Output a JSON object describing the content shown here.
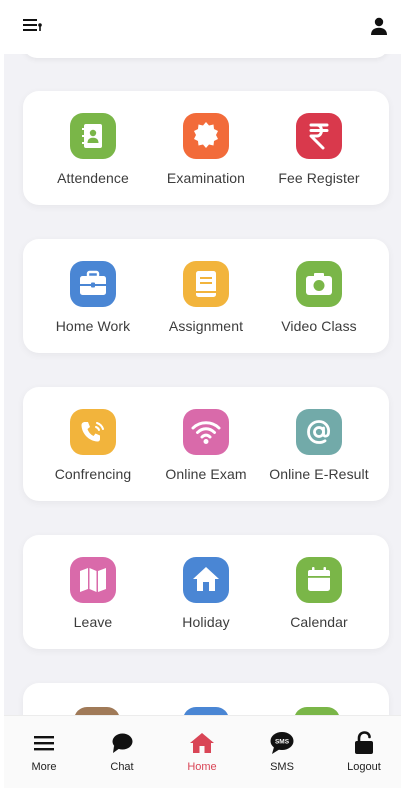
{
  "header": {
    "menu_icon": "menu-lines-icon",
    "user_icon": "user-icon"
  },
  "colors": {
    "green": "#7ab648",
    "orange": "#f26b3a",
    "red": "#d9394c",
    "blue": "#4a86d4",
    "yellow": "#f2b43c",
    "pink": "#d96aaa",
    "teal": "#72aaa9",
    "brown": "#a07a58",
    "active": "#d94556"
  },
  "cards": [
    {
      "items": [
        {
          "label": "Attendence",
          "icon": "contact-book-icon",
          "color": "#7ab648"
        },
        {
          "label": "Examination",
          "icon": "badge-icon",
          "color": "#f26b3a"
        },
        {
          "label": "Fee Register",
          "icon": "rupee-icon",
          "color": "#d9394c"
        }
      ]
    },
    {
      "items": [
        {
          "label": "Home Work",
          "icon": "briefcase-icon",
          "color": "#4a86d4"
        },
        {
          "label": "Assignment",
          "icon": "book-icon",
          "color": "#f2b43c"
        },
        {
          "label": "Video Class",
          "icon": "camera-icon",
          "color": "#7ab648"
        }
      ]
    },
    {
      "items": [
        {
          "label": "Confrencing",
          "icon": "phone-ringing-icon",
          "color": "#f2b43c"
        },
        {
          "label": "Online Exam",
          "icon": "wifi-icon",
          "color": "#d96aaa"
        },
        {
          "label": "Online E-Result",
          "icon": "at-sign-icon",
          "color": "#72aaa9"
        }
      ]
    },
    {
      "items": [
        {
          "label": "Leave",
          "icon": "map-icon",
          "color": "#d96aaa"
        },
        {
          "label": "Holiday",
          "icon": "home-icon",
          "color": "#4a86d4"
        },
        {
          "label": "Calendar",
          "icon": "calendar-icon",
          "color": "#7ab648"
        }
      ]
    }
  ],
  "bottom_nav": [
    {
      "label": "More",
      "icon": "hamburger-icon"
    },
    {
      "label": "Chat",
      "icon": "chat-bubble-icon"
    },
    {
      "label": "Home",
      "icon": "home-icon",
      "active": true
    },
    {
      "label": "SMS",
      "icon": "sms-bubble-icon"
    },
    {
      "label": "Logout",
      "icon": "unlock-icon"
    }
  ]
}
